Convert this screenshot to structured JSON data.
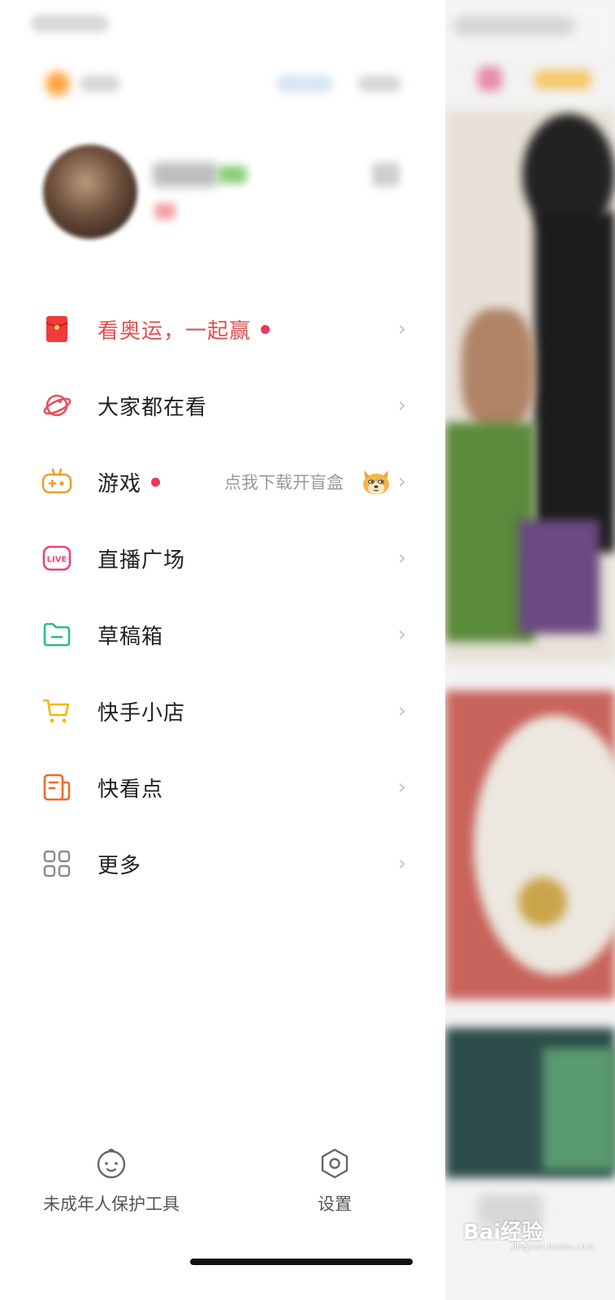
{
  "menu": {
    "items": [
      {
        "label": "看奥运，一起赢",
        "icon": "red-envelope-icon",
        "badge": true,
        "color": "#e0504f"
      },
      {
        "label": "大家都在看",
        "icon": "planet-icon",
        "badge": false,
        "color": "#e8505b"
      },
      {
        "label": "游戏",
        "icon": "gamepad-icon",
        "badge": true,
        "hint": "点我下载开盲盒",
        "color": "#f39c2c"
      },
      {
        "label": "直播广场",
        "icon": "live-icon",
        "badge": false,
        "live_text": "LIVE",
        "color": "#e9457a"
      },
      {
        "label": "草稿箱",
        "icon": "folder-icon",
        "badge": false,
        "color": "#2cb98a"
      },
      {
        "label": "快手小店",
        "icon": "cart-icon",
        "badge": false,
        "color": "#f5b800"
      },
      {
        "label": "快看点",
        "icon": "news-icon",
        "badge": false,
        "color": "#f06a2a"
      },
      {
        "label": "更多",
        "icon": "grid-icon",
        "badge": false,
        "color": "#8a8a8a"
      }
    ]
  },
  "footer": {
    "minor_protection_label": "未成年人保护工具",
    "settings_label": "设置"
  },
  "watermark": {
    "brand": "Bai经验",
    "sub": "jingyan.baidu.com"
  },
  "colors": {
    "badge_dot": "#f0335a",
    "chevron": "#c4c4c4",
    "highlight_text": "#e0504f"
  }
}
